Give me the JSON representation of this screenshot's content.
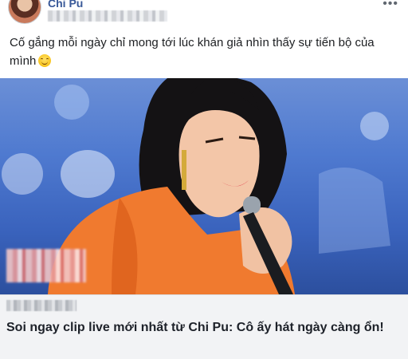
{
  "post": {
    "author": "Chi Pu",
    "more_glyph": "•••",
    "message": "Cố gắng mỗi ngày chỉ mong tới lúc khán giả nhìn thấy sự tiến bộ của mình",
    "emoji": "smiling-face-icon"
  },
  "link": {
    "title": "Soi ngay clip live mới nhất từ Chi Pu: Cô ấy hát ngày càng ổn!"
  }
}
